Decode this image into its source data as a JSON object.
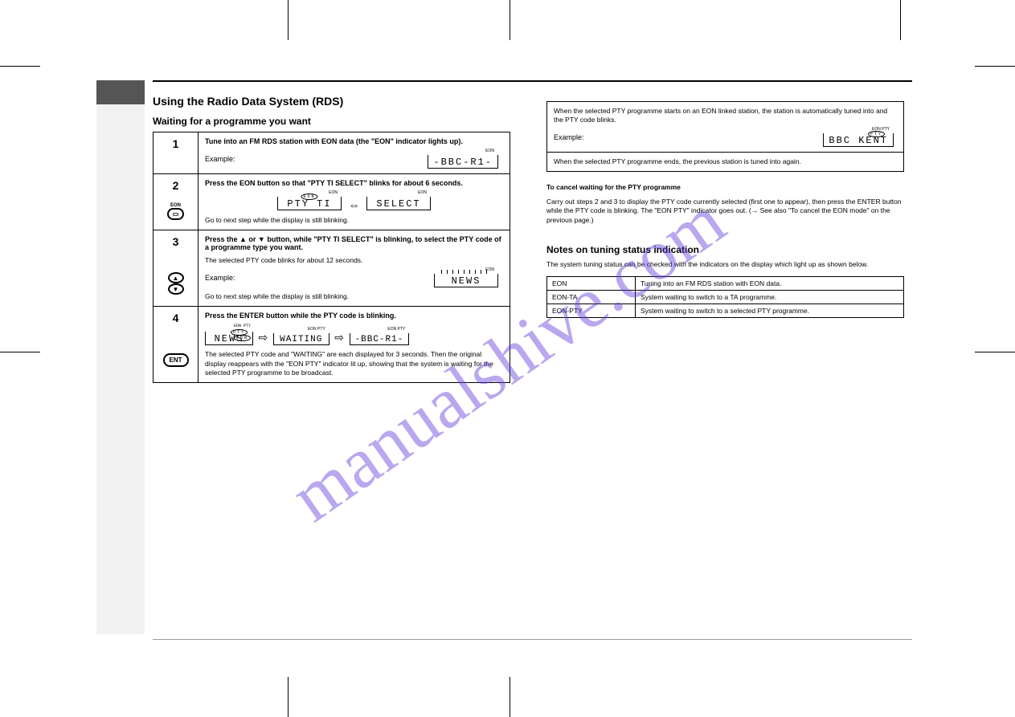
{
  "sectionTitle": "Using the Radio Data System (RDS)",
  "leftSubtitle": "Waiting for a programme you want",
  "step1": {
    "label": "1",
    "text": "Tune into an FM RDS station with EON data (the \"EON\" indicator lights up).",
    "example": "Example:",
    "lcd": "-BBC-R1-",
    "lcdTag": "EON"
  },
  "step2": {
    "label": "2",
    "text1": "Press the EON button so that \"PTY TI SELECT\" blinks for about 6 seconds.",
    "lcd1": "PTY TI",
    "lcd1Tag": "EON",
    "lcd2": "SELECT",
    "lcd2Tag": "EON",
    "note": "Go to next step while the display is still blinking."
  },
  "step3": {
    "label": "3",
    "text1": "Press the ▲ or ▼ button, while \"PTY TI SELECT\" is blinking, to select the PTY code of a programme type you want.",
    "text2": "The selected PTY code blinks for about 12 seconds.",
    "example": "Example:",
    "lcd": "NEWS",
    "lcdTag": "EON",
    "note": "Go to next step while the display is still blinking."
  },
  "step4": {
    "label": "4",
    "text1": "Press the ENTER button while the PTY code is blinking.",
    "lcd1": "NEWS",
    "lcd1Sub": "EON PTY",
    "lcd2": "WAITING",
    "lcd2Tag": "EON PTY",
    "lcd3": "-BBC-R1-",
    "lcd3Tag": "EON PTY",
    "text2": "The selected PTY code and \"WAITING\" are each displayed for 3 seconds. Then the original display reappears with the \"EON PTY\" indicator lit up, showing that the system is waiting for the selected PTY programme to be broadcast."
  },
  "right1": {
    "text1": "When the selected PTY programme starts on an EON linked station, the station is automatically tuned into and the PTY code blinks.",
    "example": "Example:",
    "lcd": "BBC KENT",
    "lcdTag": "EON PTY",
    "text2": "When the selected PTY programme ends, the previous station is tuned into again."
  },
  "cancelHeader": "To cancel waiting for the PTY programme",
  "cancelText": "Carry out steps 2 and 3 to display the PTY code currently selected (first one to appear), then press the ENTER button while the PTY code is blinking. The \"EON PTY\" indicator goes out. (→ See also \"To cancel the EON mode\" on the previous page.)",
  "notesHeader": "Notes on tuning status indication",
  "notesText": "The system tuning status can be checked with the indicators on the display which light up as shown below.",
  "eonTable": {
    "r1c1": "EON",
    "r1c2": "Tuning into an FM RDS station with EON data.",
    "r2c1": "EON-TA",
    "r2c2": "System waiting to switch to a TA programme.",
    "r3c1": "EON-PTY",
    "r3c2": "System waiting to switch to a selected PTY programme."
  }
}
